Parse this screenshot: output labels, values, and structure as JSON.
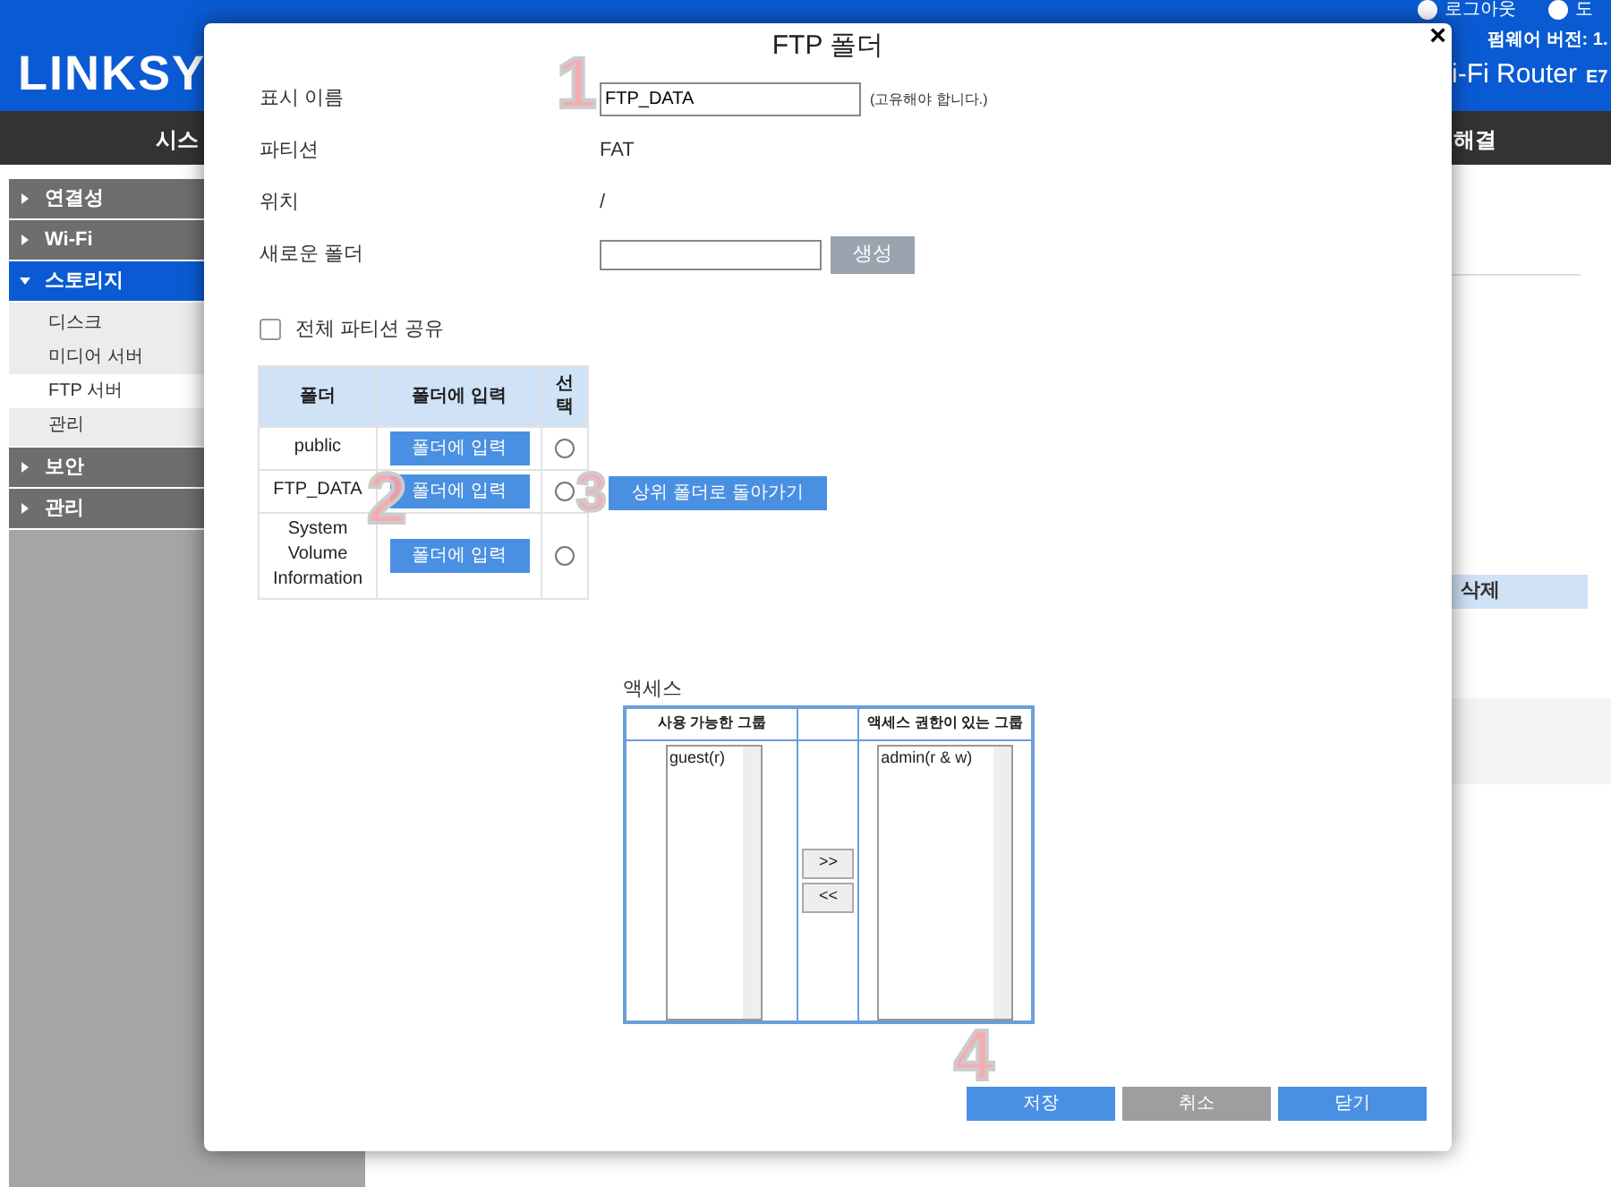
{
  "header": {
    "logo": "LINKSY",
    "top_links": [
      "로그아웃",
      "도"
    ],
    "firmware": "펌웨어 버전: 1.",
    "product": "i-Fi Router",
    "model": "E7"
  },
  "nav": {
    "items": [
      "시스",
      "해결"
    ]
  },
  "sidebar": {
    "items": [
      {
        "label": "연결성",
        "expanded": false,
        "selected": false
      },
      {
        "label": "Wi-Fi",
        "expanded": false,
        "selected": false
      },
      {
        "label": "스토리지",
        "expanded": true,
        "selected": true,
        "children": [
          {
            "label": "디스크",
            "selected": false
          },
          {
            "label": "미디어 서버",
            "selected": false
          },
          {
            "label": "FTP 서버",
            "selected": true
          },
          {
            "label": "관리",
            "selected": false
          }
        ]
      },
      {
        "label": "보안",
        "expanded": false,
        "selected": false
      },
      {
        "label": "관리",
        "expanded": false,
        "selected": false
      }
    ]
  },
  "background_table": {
    "column": "삭제"
  },
  "dialog": {
    "title": "FTP 폴더",
    "close": "×",
    "fields": [
      {
        "kind": "input",
        "label": "표시 이름",
        "value": "FTP_DATA",
        "note": "(고유해야 합니다.)"
      },
      {
        "kind": "text",
        "label": "파티션",
        "value": "FAT"
      },
      {
        "kind": "text",
        "label": "위치",
        "value": "/"
      },
      {
        "kind": "create",
        "label": "새로운 폴더",
        "button": "생성",
        "disabled": true
      }
    ],
    "share_all": {
      "label": "전체 파티션 공유",
      "checked": false
    },
    "folders": {
      "columns": [
        "폴더",
        "폴더에 입력",
        "선\n택"
      ],
      "rows": [
        {
          "name": "public",
          "button": "폴더에 입력",
          "selected": false
        },
        {
          "name": "FTP_DATA",
          "button": "폴더에 입력",
          "selected": false
        },
        {
          "name": "System Volume Information",
          "button": "폴더에 입력",
          "selected": false
        }
      ]
    },
    "go_up_button": "상위 폴더로 돌아가기",
    "access": {
      "label": "액세스",
      "available_header": "사용 가능한 그룹",
      "granted_header": "액세스 권한이 있는 그룹",
      "available": [
        "guest(r)"
      ],
      "granted": [
        "admin(r & w)"
      ],
      "add": ">>",
      "remove": "<<"
    },
    "buttons": [
      {
        "label": "저장",
        "kind": "primary"
      },
      {
        "label": "취소",
        "kind": "secondary"
      },
      {
        "label": "닫기",
        "kind": "primary"
      }
    ]
  },
  "callouts": [
    "1",
    "2",
    "3",
    "4"
  ]
}
